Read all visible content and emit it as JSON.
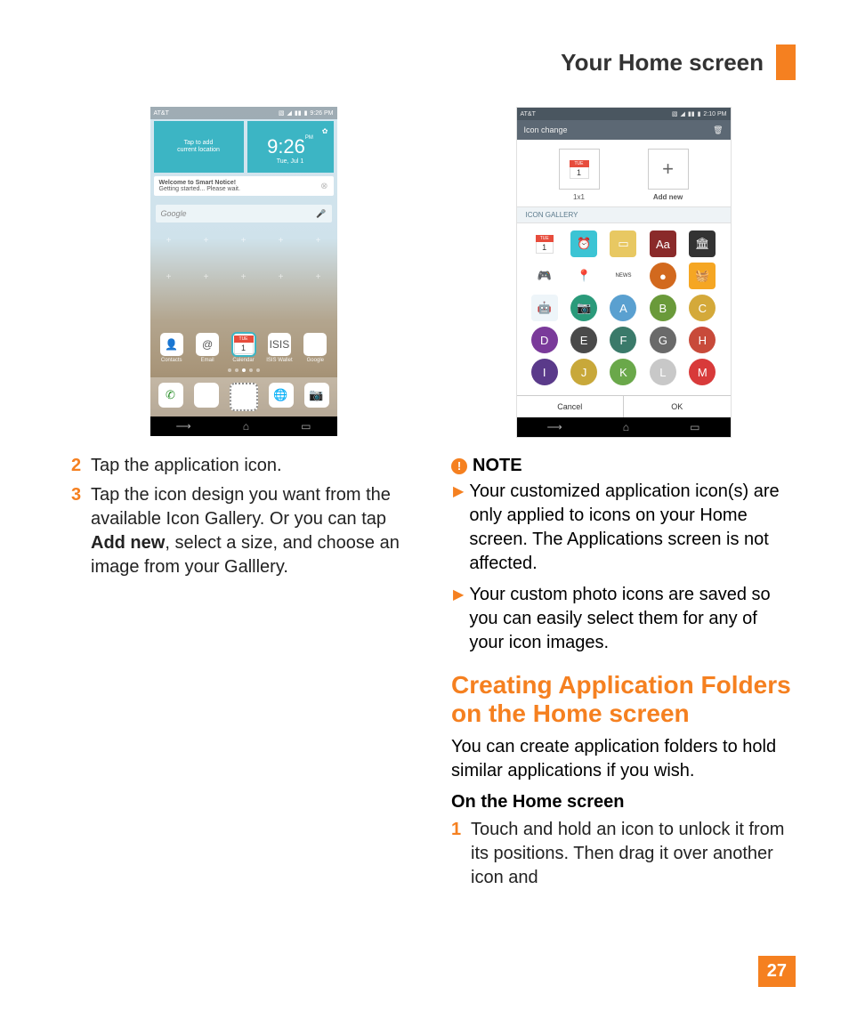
{
  "header": {
    "title": "Your Home screen"
  },
  "left": {
    "phone": {
      "carrier": "AT&T",
      "time": "9:26 PM",
      "loc_line1": "Tap to add",
      "loc_line2": "current location",
      "clock_time": "9:26",
      "clock_suffix": "PM",
      "clock_date": "Tue, Jul 1",
      "notice_title": "Welcome to Smart Notice!",
      "notice_sub": "Getting started... Please wait.",
      "search_placeholder": "Google",
      "apps": [
        {
          "label": "Contacts"
        },
        {
          "label": "Email"
        },
        {
          "label": "Calendar",
          "selected": true,
          "day": "1",
          "dow": "TUE"
        },
        {
          "label": "ISIS Wallet"
        },
        {
          "label": "Google"
        }
      ]
    },
    "steps": [
      {
        "num": "2",
        "text": "Tap the application icon."
      },
      {
        "num": "3",
        "text_before": "Tap the icon design you want from the available Icon Gallery. Or you can tap ",
        "bold": "Add new",
        "text_after": ", select a size, and choose an image from your Galllery."
      }
    ]
  },
  "right": {
    "phone": {
      "carrier": "AT&T",
      "time": "2:10 PM",
      "title": "Icon change",
      "size1_label": "1x1",
      "size1_day": "1",
      "size1_dow": "TUE",
      "size2_label": "Add new",
      "gallery_header": "ICON GALLERY",
      "cancel": "Cancel",
      "ok": "OK",
      "icons": [
        {
          "t": "cal",
          "day": "1",
          "dow": "TUE"
        },
        {
          "t": "sq",
          "bg": "#3cc4d4",
          "glyph": "⏰"
        },
        {
          "t": "sq",
          "bg": "#e8c862",
          "glyph": "▭"
        },
        {
          "t": "sq",
          "bg": "#8a2a2a",
          "glyph": "Aa"
        },
        {
          "t": "sq",
          "bg": "#333",
          "glyph": "🏛"
        },
        {
          "t": "sq",
          "bg": "#fff",
          "glyph": "🎮",
          "fg": "#555"
        },
        {
          "t": "sq",
          "bg": "#fff",
          "glyph": "📍",
          "fg": "#e74c3c"
        },
        {
          "t": "sq",
          "bg": "#fff",
          "glyph": "NEWS",
          "fg": "#333",
          "fs": "6px"
        },
        {
          "t": "rnd",
          "bg": "#d2691e",
          "glyph": "●"
        },
        {
          "t": "sq",
          "bg": "#f5a623",
          "glyph": "🧺"
        },
        {
          "t": "sq",
          "bg": "#eef5f9",
          "glyph": "🤖",
          "fg": "#2196F3"
        },
        {
          "t": "rnd",
          "bg": "#2a9a7a",
          "glyph": "📷"
        },
        {
          "t": "rnd",
          "bg": "#5aa0d0",
          "glyph": "A"
        },
        {
          "t": "rnd",
          "bg": "#6a9a3a",
          "glyph": "B"
        },
        {
          "t": "rnd",
          "bg": "#d4a93a",
          "glyph": "C"
        },
        {
          "t": "rnd",
          "bg": "#7a3a9a",
          "glyph": "D"
        },
        {
          "t": "rnd",
          "bg": "#4a4a4a",
          "glyph": "E"
        },
        {
          "t": "rnd",
          "bg": "#3a7a6a",
          "glyph": "F"
        },
        {
          "t": "rnd",
          "bg": "#6a6a6a",
          "glyph": "G"
        },
        {
          "t": "rnd",
          "bg": "#c84a3a",
          "glyph": "H"
        },
        {
          "t": "rnd",
          "bg": "#5a3a8a",
          "glyph": "I"
        },
        {
          "t": "rnd",
          "bg": "#c8a83a",
          "glyph": "J"
        },
        {
          "t": "rnd",
          "bg": "#6aa84a",
          "glyph": "K"
        },
        {
          "t": "rnd",
          "bg": "#c8c8c8",
          "glyph": "L"
        },
        {
          "t": "rnd",
          "bg": "#d83a3a",
          "glyph": "M"
        }
      ]
    },
    "note_label": "NOTE",
    "bullets": [
      "Your customized application icon(s) are only applied to icons on your Home screen. The Applications screen is not affected.",
      "Your custom photo icons are saved so you can easily select them for any of your icon images."
    ],
    "heading": "Creating Application Folders on the Home screen",
    "para": "You can create application folders to hold similar applications if you wish.",
    "subhead": "On the Home screen",
    "step1": {
      "num": "1",
      "text": "Touch and hold an icon to unlock it from its positions. Then drag it over another icon and"
    }
  },
  "page_number": "27"
}
